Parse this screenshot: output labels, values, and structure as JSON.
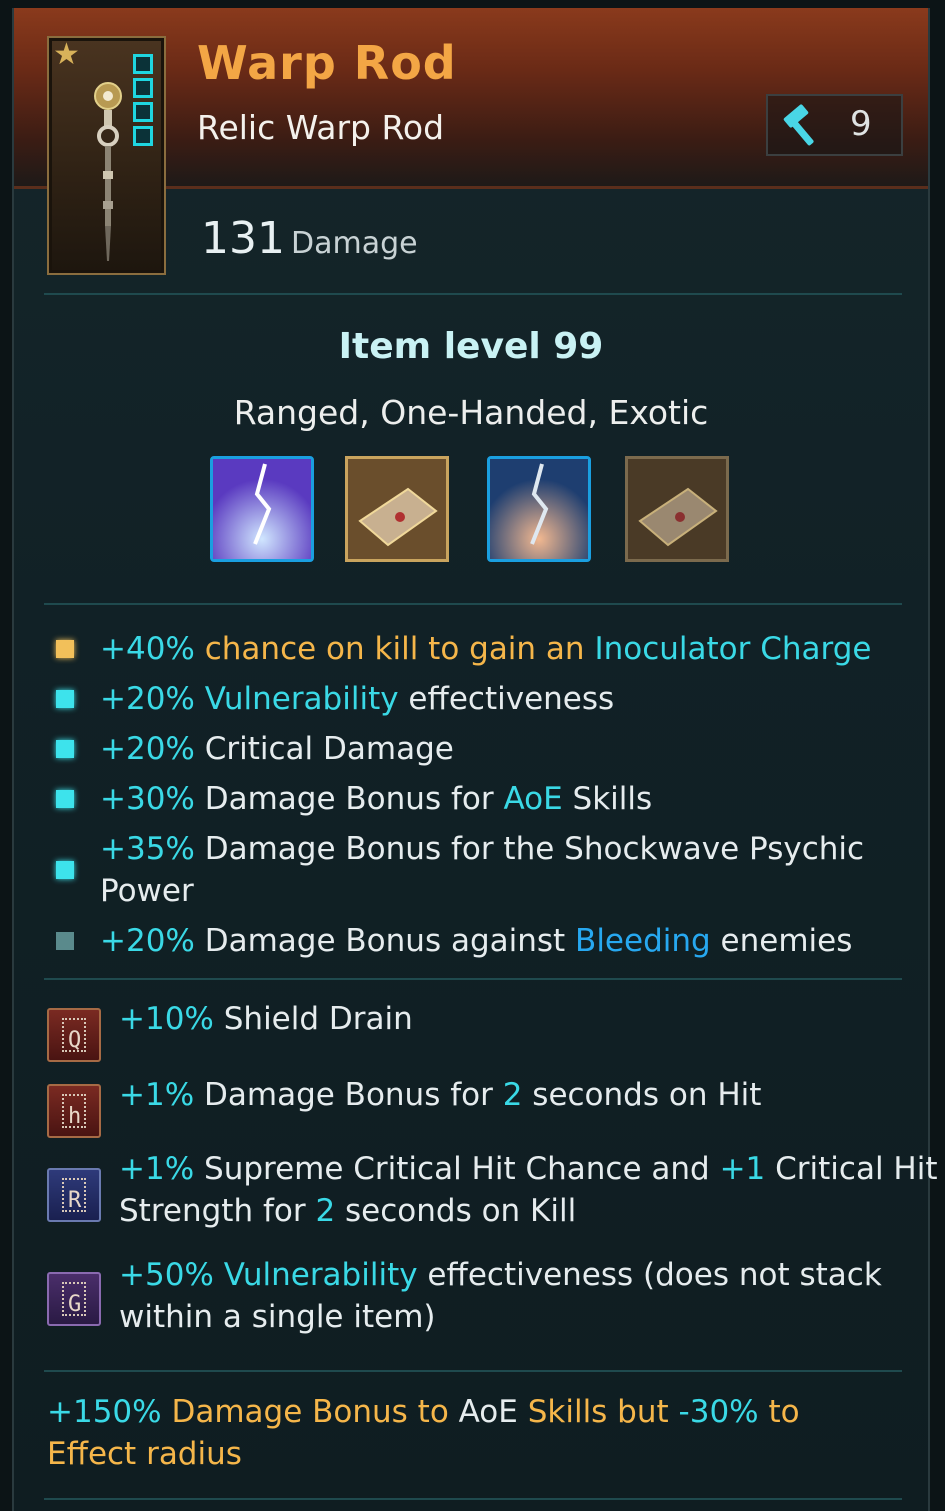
{
  "item": {
    "name": "Warp Rod",
    "type": "Relic Warp Rod",
    "upgrade_level": "9",
    "damage_value": "131",
    "damage_label": "Damage",
    "item_level": "Item level 99",
    "tags": "Ranged, One-Handed, Exotic"
  },
  "skill_icons": [
    {
      "name": "lightning-strike-skill-icon-blue"
    },
    {
      "name": "psychic-book-skill-icon-gold"
    },
    {
      "name": "lightning-strike-skill-icon-orange"
    },
    {
      "name": "psychic-book-skill-icon-dim"
    }
  ],
  "affixes": [
    {
      "bullet": "gold",
      "parts": [
        [
          "+40%",
          "cyan"
        ],
        [
          " chance on kill to gain an ",
          "gold"
        ],
        [
          "Inoculator Charge",
          "cyan"
        ]
      ]
    },
    {
      "bullet": "cyan",
      "parts": [
        [
          "+20% ",
          "cyan"
        ],
        [
          "Vulnerability",
          "cyan"
        ],
        [
          " effectiveness",
          "white"
        ]
      ]
    },
    {
      "bullet": "cyan",
      "parts": [
        [
          "+20%",
          "cyan"
        ],
        [
          " Critical Damage",
          "white"
        ]
      ]
    },
    {
      "bullet": "cyan",
      "parts": [
        [
          "+30%",
          "cyan"
        ],
        [
          " Damage Bonus for ",
          "white"
        ],
        [
          "AoE",
          "cyan"
        ],
        [
          " Skills",
          "white"
        ]
      ]
    },
    {
      "bullet": "cyan",
      "parts": [
        [
          "+35%",
          "cyan"
        ],
        [
          " Damage Bonus for the Shockwave Psychic Power",
          "white"
        ]
      ]
    },
    {
      "bullet": "dim",
      "parts": [
        [
          "+20%",
          "cyan"
        ],
        [
          " Damage Bonus against ",
          "white"
        ],
        [
          "Bleeding",
          "blue"
        ],
        [
          " enemies",
          "white"
        ]
      ]
    }
  ],
  "runes": [
    {
      "color": "red",
      "glyph": "Q",
      "parts": [
        [
          "+10%",
          "cyan"
        ],
        [
          " Shield Drain",
          "white"
        ]
      ]
    },
    {
      "color": "red",
      "glyph": "h",
      "parts": [
        [
          "+1%",
          "cyan"
        ],
        [
          " Damage Bonus for ",
          "white"
        ],
        [
          "2",
          "cyan"
        ],
        [
          " seconds on Hit",
          "white"
        ]
      ]
    },
    {
      "color": "blue",
      "glyph": "R",
      "parts": [
        [
          "+1%",
          "cyan"
        ],
        [
          " Supreme Critical Hit Chance and ",
          "white"
        ],
        [
          "+1",
          "cyan"
        ],
        [
          " Critical Hit Strength for ",
          "white"
        ],
        [
          "2",
          "cyan"
        ],
        [
          " seconds on Kill",
          "white"
        ]
      ]
    },
    {
      "color": "purple",
      "glyph": "G",
      "parts": [
        [
          "+50% ",
          "cyan"
        ],
        [
          "Vulnerability",
          "cyan"
        ],
        [
          " effectiveness (does not stack within a single item)",
          "white"
        ]
      ]
    }
  ],
  "legendary_text": [
    [
      "+150%",
      "cyan"
    ],
    [
      " Damage Bonus to ",
      "gold"
    ],
    [
      "AoE",
      "white"
    ],
    [
      " Skills but ",
      "gold"
    ],
    [
      "-30%",
      "cyan"
    ],
    [
      " to Effect radius",
      "gold"
    ]
  ],
  "colors": {
    "title": "#f3a645",
    "accent_cyan": "#3ad9e6",
    "accent_gold": "#f5b64a",
    "accent_blue": "#27a8f0"
  }
}
